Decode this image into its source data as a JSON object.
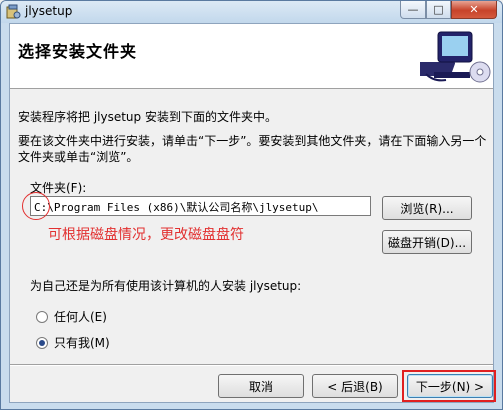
{
  "window": {
    "title": "jlysetup",
    "min_glyph": "—",
    "max_glyph": "□",
    "close_glyph": "✕"
  },
  "header": {
    "title": "选择安装文件夹"
  },
  "intro": {
    "line1": "安装程序将把 jlysetup 安装到下面的文件夹中。",
    "line2": "要在该文件夹中进行安装，请单击“下一步”。要安装到其他文件夹，请在下面输入另一个文件夹或单击“浏览”。"
  },
  "folder": {
    "label": "文件夹(F):",
    "path": "C:\\Program Files (x86)\\默认公司名称\\jlysetup\\",
    "browse_label": "浏览(R)...",
    "disk_cost_label": "磁盘开销(D)...",
    "hint": "可根据磁盘情况，更改磁盘盘符",
    "hint_color": "#e23030"
  },
  "install_for": {
    "label": "为自己还是为所有使用该计算机的人安装 jlysetup:",
    "options": [
      {
        "label": "任何人(E)",
        "selected": false
      },
      {
        "label": "只有我(M)",
        "selected": true
      }
    ]
  },
  "footer": {
    "cancel_label": "取消",
    "back_label": "< 后退(B)",
    "next_label": "下一步(N) >",
    "highlight_color": "#e02020"
  }
}
